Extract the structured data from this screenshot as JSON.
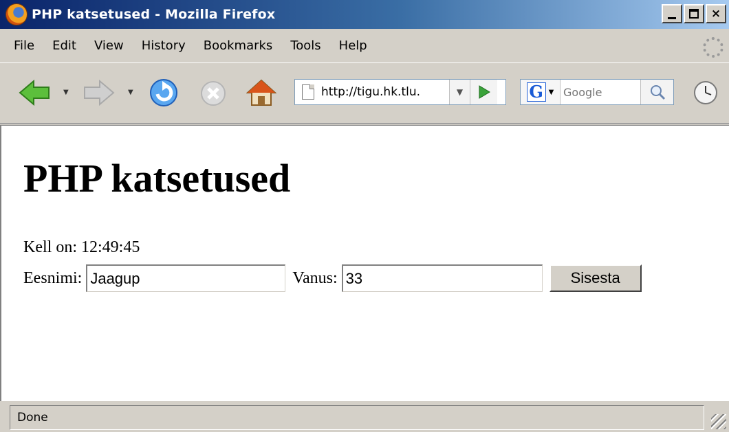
{
  "window": {
    "title": "PHP katsetused - Mozilla Firefox",
    "minimize_label": "_",
    "close_label": "×"
  },
  "menu": {
    "items": [
      "File",
      "Edit",
      "View",
      "History",
      "Bookmarks",
      "Tools",
      "Help"
    ]
  },
  "toolbar": {
    "url": "http://tigu.hk.tlu.",
    "search_placeholder": "Google",
    "search_engine_letter": "G"
  },
  "page": {
    "title": "PHP katsetused",
    "clock_label": "Kell on:",
    "clock_value": "12:49:45",
    "firstname_label": "Eesnimi:",
    "firstname_value": "Jaagup",
    "age_label": "Vanus:",
    "age_value": "33",
    "submit_label": "Sisesta"
  },
  "status": {
    "text": "Done"
  },
  "colors": {
    "titlebar_start": "#0a246a",
    "titlebar_end": "#a6caf0",
    "chrome": "#d4d0c8",
    "go_green": "#3aa33a",
    "reload_blue": "#2a7ad8"
  }
}
